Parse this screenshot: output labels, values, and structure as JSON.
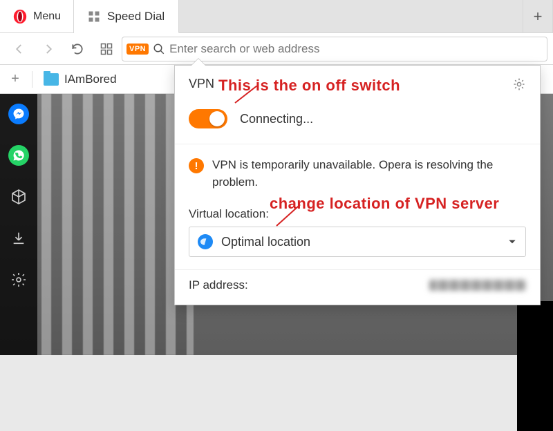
{
  "menu": {
    "label": "Menu"
  },
  "tab": {
    "title": "Speed Dial"
  },
  "toolbar": {
    "vpn_badge": "VPN",
    "omnibox_placeholder": "Enter search or web address"
  },
  "bookmarks": {
    "folder_name": "IAmBored"
  },
  "vpn_panel": {
    "title": "VPN",
    "status": "Connecting...",
    "warning": "VPN is temporarily unavailable. Opera is resolving the problem.",
    "virtual_location_label": "Virtual location:",
    "selected_location": "Optimal location",
    "ip_label": "IP address:"
  },
  "annotations": {
    "switch": "This is the on off switch",
    "location": "change location of VPN server"
  }
}
